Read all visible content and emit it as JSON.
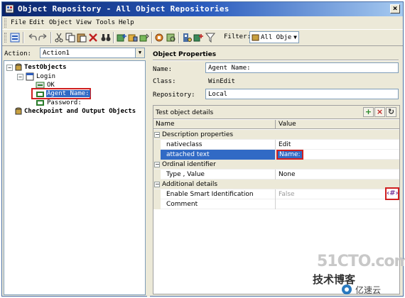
{
  "window": {
    "title": "Object Repository - All Object Repositories",
    "close_glyph": "×"
  },
  "menu": [
    "File",
    "Edit",
    "Object",
    "View",
    "Tools",
    "Help"
  ],
  "toolbar": {
    "filter_label": "Filter:",
    "filter_value": "All Obje"
  },
  "action": {
    "label": "Action:",
    "value": "Action1"
  },
  "tree": {
    "root": "TestObjects",
    "login": "Login",
    "ok": "OK",
    "agent_name": "Agent Name:",
    "password": "Password:",
    "checkpoints": "Checkpoint and Output Objects"
  },
  "properties": {
    "header": "Object Properties",
    "name_label": "Name:",
    "name_value": "Agent Name:",
    "class_label": "Class:",
    "class_value": "WinEdit",
    "repository_label": "Repository:",
    "repository_value": "Local"
  },
  "details": {
    "title": "Test object details",
    "col_name": "Name",
    "col_value": "Value",
    "rows": [
      {
        "type": "group",
        "name": "Description properties"
      },
      {
        "type": "item",
        "name": "nativeclass",
        "value": "Edit"
      },
      {
        "type": "item",
        "name": "attached text",
        "value": "Name:",
        "selected": true
      },
      {
        "type": "group",
        "name": "Ordinal identifier"
      },
      {
        "type": "item",
        "name": "Type , Value",
        "value": "None"
      },
      {
        "type": "group",
        "name": "Additional details"
      },
      {
        "type": "item",
        "name": "Enable Smart Identification",
        "value": "False",
        "disabled": true
      },
      {
        "type": "item",
        "name": "Comment",
        "value": ""
      }
    ],
    "add_glyph": "+",
    "remove_glyph": "×",
    "refresh_glyph": "↻",
    "param_glyph": "‹#›"
  },
  "watermark": {
    "site": "51CTO.com",
    "line": "技术博客",
    "brand": "亿速云"
  },
  "colors": {
    "titlebar": "#0a246a",
    "selection": "#316ac5",
    "highlight_box": "#d02020"
  }
}
